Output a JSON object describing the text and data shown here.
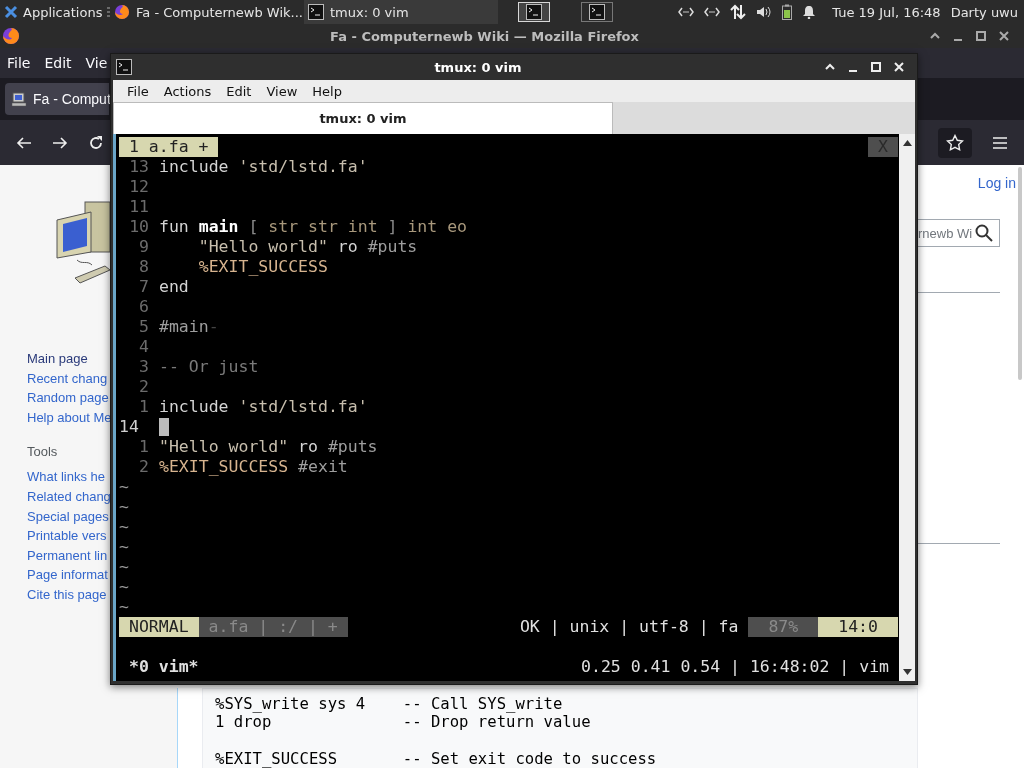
{
  "panel": {
    "apps_label": "Applications",
    "tasks": [
      {
        "label": "Fa - Computernewb Wik...",
        "kind": "browser",
        "selected": false
      },
      {
        "label": "tmux: 0 vim",
        "kind": "terminal",
        "selected": true
      }
    ],
    "workspaces": [
      {
        "selected": true
      },
      {
        "selected": false
      }
    ],
    "clock": "Tue 19 Jul, 16:48",
    "user": "Darty uwu"
  },
  "browser": {
    "title": "Fa - Computernewb Wiki — Mozilla Firefox",
    "menu": [
      "File",
      "Edit",
      "Vie"
    ],
    "tab": "Fa - Comput",
    "sidebar": {
      "nav": [
        {
          "label": "Main page",
          "visited": true
        },
        {
          "label": "Recent chang",
          "visited": false
        },
        {
          "label": "Random page",
          "visited": false
        },
        {
          "label": "Help about Me",
          "visited": false
        }
      ],
      "tools_heading": "Tools",
      "tools": [
        {
          "label": "What links he",
          "visited": false
        },
        {
          "label": "Related chang",
          "visited": false
        },
        {
          "label": "Special pages",
          "visited": false
        },
        {
          "label": "Printable vers",
          "visited": false
        },
        {
          "label": "Permanent lin",
          "visited": false
        },
        {
          "label": "Page informat",
          "visited": false
        },
        {
          "label": "Cite this page",
          "visited": false
        }
      ]
    },
    "login": "Log in",
    "search_value": "rnewb Wi",
    "code": [
      {
        "lines": [
          "%SYS_write sys 4    -- Call SYS_write",
          "1 drop              -- Drop return value"
        ]
      },
      {
        "lines": [
          "%EXIT_SUCCESS       -- Set exit code to success"
        ]
      }
    ]
  },
  "terminal": {
    "title": "tmux: 0 vim",
    "menu": [
      "File",
      "Actions",
      "Edit",
      "View",
      "Help"
    ],
    "tabs": [
      {
        "label": "tmux: 0 vim",
        "selected": true
      }
    ],
    "vim": {
      "tabline": {
        "tab": "1 a.fa +",
        "close": "X"
      },
      "lines": [
        {
          "number": "13",
          "current": false,
          "cursor": false,
          "tokens": [
            {
              "text": "include",
              "kind": "keyword"
            },
            {
              "text": " 'std/lstd.fa'",
              "kind": "string"
            }
          ]
        },
        {
          "number": "12",
          "current": false,
          "cursor": false
        },
        {
          "number": "11",
          "current": false,
          "cursor": false
        },
        {
          "number": "10",
          "current": false,
          "cursor": false,
          "tokens": [
            {
              "text": "fun",
              "kind": "keyword"
            },
            {
              "text": " main",
              "kind": "func"
            },
            {
              "text": " [ ",
              "kind": "bracket"
            },
            {
              "text": "str str int",
              "kind": "type"
            },
            {
              "text": " ] ",
              "kind": "bracket"
            },
            {
              "text": "int eo",
              "kind": "type"
            }
          ]
        },
        {
          "number": "9",
          "current": false,
          "cursor": false,
          "tokens": [
            {
              "text": "    \"Hello world\"",
              "kind": "string"
            },
            {
              "text": " ro",
              "kind": "keyword"
            },
            {
              "text": " #puts",
              "kind": "call"
            }
          ]
        },
        {
          "number": "8",
          "current": false,
          "cursor": false,
          "tokens": [
            {
              "text": "    %EXIT_SUCCESS",
              "kind": "macro"
            }
          ]
        },
        {
          "number": "7",
          "current": false,
          "cursor": false,
          "tokens": [
            {
              "text": "end",
              "kind": "keyword"
            }
          ]
        },
        {
          "number": "6",
          "current": false,
          "cursor": false
        },
        {
          "number": "5",
          "current": false,
          "cursor": false,
          "tokens": [
            {
              "text": "#main",
              "kind": "call"
            },
            {
              "text": "-",
              "kind": "faint"
            }
          ]
        },
        {
          "number": "4",
          "current": false,
          "cursor": false
        },
        {
          "number": "3",
          "current": false,
          "cursor": false,
          "tokens": [
            {
              "text": "-- Or just",
              "kind": "comment"
            }
          ]
        },
        {
          "number": "2",
          "current": false,
          "cursor": false
        },
        {
          "number": "1",
          "current": false,
          "cursor": false,
          "tokens": [
            {
              "text": "include",
              "kind": "keyword"
            },
            {
              "text": " 'std/lstd.fa'",
              "kind": "string"
            }
          ]
        },
        {
          "number": "14",
          "current": true,
          "cursor": true
        },
        {
          "number": "1",
          "current": false,
          "cursor": false,
          "tokens": [
            {
              "text": "\"Hello world\"",
              "kind": "string"
            },
            {
              "text": " ro",
              "kind": "keyword"
            },
            {
              "text": " #puts",
              "kind": "call"
            }
          ]
        },
        {
          "number": "2",
          "current": false,
          "cursor": false,
          "tokens": [
            {
              "text": "%EXIT_SUCCESS",
              "kind": "macro"
            },
            {
              "text": " #exit",
              "kind": "call"
            }
          ]
        }
      ],
      "filler": [
        "~",
        "~",
        "~",
        "~",
        "~",
        "~",
        "~"
      ],
      "status": [
        {
          "text": "NORMAL",
          "kind": "mode"
        },
        {
          "text": "a.fa | :/ | +",
          "kind": "file"
        },
        {
          "text": "OK | unix | utf-8 | fa",
          "kind": "info"
        },
        {
          "text": "87%",
          "kind": "percent"
        },
        {
          "text": "14:0",
          "kind": "position"
        }
      ]
    },
    "tmux_status": {
      "left": "*0 vim*",
      "right": "0.25 0.41 0.54 | 16:48:02 | vim"
    }
  }
}
